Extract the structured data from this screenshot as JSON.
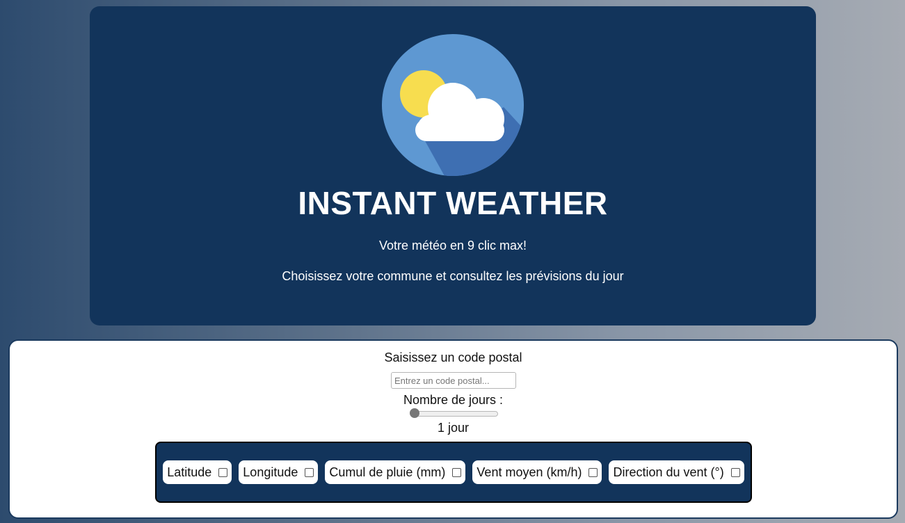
{
  "header": {
    "logo_icon": "weather-sun-cloud-icon",
    "title": "INSTANT WEATHER",
    "tagline": "Votre météo en 9 clic max!",
    "subtitle": "Choisissez votre commune et consultez les prévisions du jour"
  },
  "form": {
    "postal_label": "Saisissez un code postal",
    "postal_placeholder": "Entrez un code postal...",
    "postal_value": "",
    "days_label": "Nombre de jours :",
    "days_slider_value": 1,
    "days_slider_fraction": 0,
    "days_value_text": "1 jour"
  },
  "options": [
    {
      "label": "Latitude",
      "checked": false
    },
    {
      "label": "Longitude",
      "checked": false
    },
    {
      "label": "Cumul de pluie (mm)",
      "checked": false
    },
    {
      "label": "Vent moyen (km/h)",
      "checked": false
    },
    {
      "label": "Direction du vent (°)",
      "checked": false
    }
  ],
  "colors": {
    "hero_background": "#12345b",
    "logo_circle": "#5e98d2",
    "logo_shadow": "#3e6fb2",
    "sun": "#f7dd4f",
    "cloud": "#ffffff"
  }
}
